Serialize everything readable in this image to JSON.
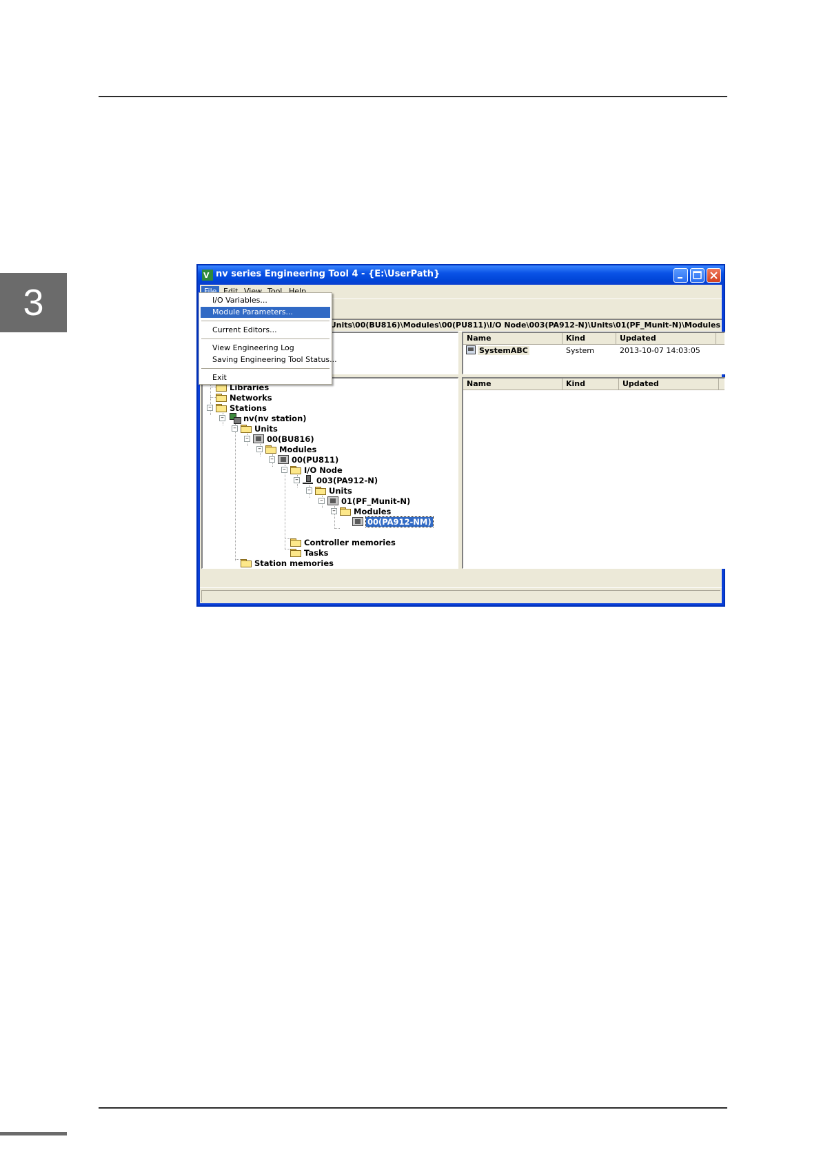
{
  "page": {
    "chapter_number": "3"
  },
  "window": {
    "title": "nv series Engineering Tool 4 - {E:\\UserPath}",
    "menu": [
      "File",
      "Edit",
      "View",
      "Tool",
      "Help"
    ],
    "path": "\\Units\\00(BU816)\\Modules\\00(PU811)\\I/O Node\\003(PA912-N)\\Units\\01(PF_Munit-N)\\Modules"
  },
  "file_menu": {
    "items": [
      "I/O Variables...",
      "Module Parameters...",
      "Current Editors...",
      "View Engineering Log",
      "Saving Engineering Tool Status...",
      "Exit"
    ],
    "highlighted": "Module Parameters..."
  },
  "tree": {
    "nodes": [
      {
        "label": "Libraries",
        "icon": "folder-icon"
      },
      {
        "label": "Networks",
        "icon": "folder-icon"
      },
      {
        "label": "Stations",
        "icon": "folder-icon"
      },
      {
        "label": "nv(nv station)",
        "icon": "station-icon"
      },
      {
        "label": "Units",
        "icon": "folder-icon"
      },
      {
        "label": "00(BU816)",
        "icon": "base-unit-icon"
      },
      {
        "label": "Modules",
        "icon": "folder-icon"
      },
      {
        "label": "00(PU811)",
        "icon": "module-icon"
      },
      {
        "label": "I/O Node",
        "icon": "folder-icon"
      },
      {
        "label": "003(PA912-N)",
        "icon": "io-node-icon"
      },
      {
        "label": "Units",
        "icon": "folder-icon"
      },
      {
        "label": "01(PF_Munit-N)",
        "icon": "base-unit-icon"
      },
      {
        "label": "Modules",
        "icon": "folder-icon"
      },
      {
        "label": "00(PA912-NM)",
        "icon": "module-icon",
        "selected": true
      },
      {
        "label": "Controller memories",
        "icon": "folder-icon"
      },
      {
        "label": "Tasks",
        "icon": "folder-icon"
      },
      {
        "label": "Station memories",
        "icon": "folder-icon"
      }
    ]
  },
  "top_list": {
    "columns": [
      "Name",
      "Kind",
      "Updated"
    ],
    "rows": [
      {
        "name": "SystemABC",
        "kind": "System",
        "updated": "2013-10-07 14:03:05",
        "icon": "system-icon"
      }
    ]
  },
  "bottom_list": {
    "columns": [
      "Name",
      "Kind",
      "Updated"
    ],
    "rows": []
  },
  "colors": {
    "titlebar": "#0a53e6",
    "selection": "#316ac5",
    "window_face": "#ece9d8"
  }
}
